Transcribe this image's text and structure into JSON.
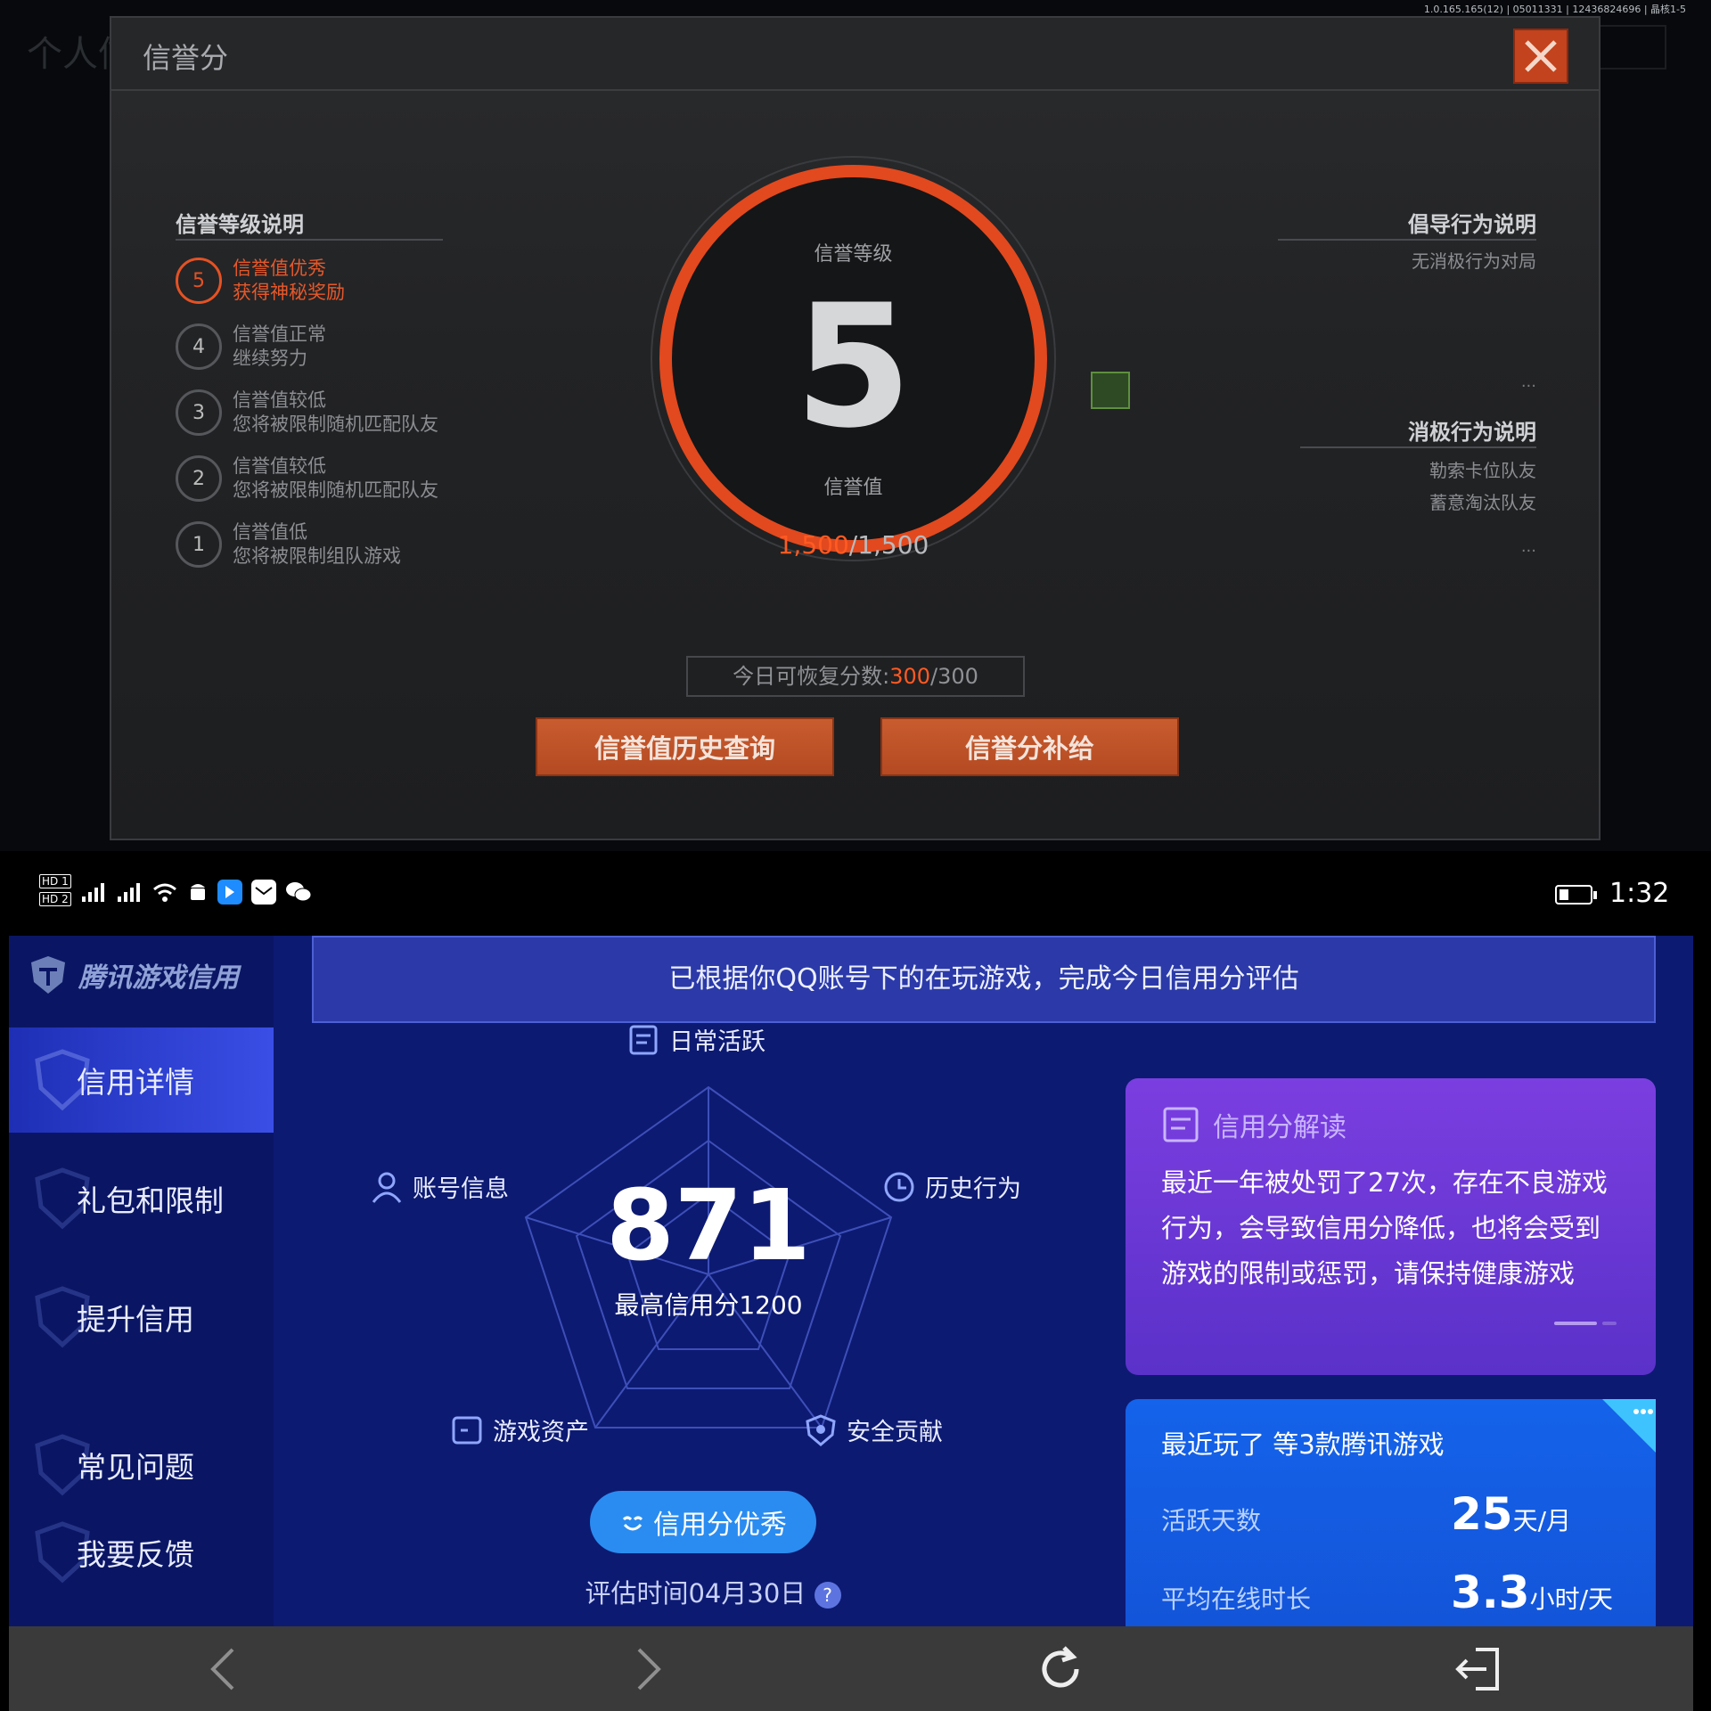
{
  "game": {
    "version": "1.0.165.165(12) | 05011331 | 12436824696 | 晶核1-5",
    "bg_title": "个人信",
    "dialog_title": "信誉分",
    "left_title": "信誉等级说明",
    "levels": [
      {
        "num": "5",
        "line1": "信誉值优秀",
        "line2": "获得神秘奖励"
      },
      {
        "num": "4",
        "line1": "信誉值正常",
        "line2": "继续努力"
      },
      {
        "num": "3",
        "line1": "信誉值较低",
        "line2": "您将被限制随机匹配队友"
      },
      {
        "num": "2",
        "line1": "信誉值较低",
        "line2": "您将被限制随机匹配队友"
      },
      {
        "num": "1",
        "line1": "信誉值低",
        "line2": "您将被限制组队游戏"
      }
    ],
    "ring": {
      "level_label": "信誉等级",
      "level": "5",
      "score_label": "信誉值",
      "score_current": "1,500",
      "score_max": "/1,500"
    },
    "advocate_title": "倡导行为说明",
    "advocate_item": "无消极行为对局",
    "negative_title": "消极行为说明",
    "negative_items": [
      "勒索卡位队友",
      "蓄意淘汰队友"
    ],
    "ellipsis": "...",
    "daily_label": "今日可恢复分数:",
    "daily_current": "300",
    "daily_max": "/300",
    "btn_history": "信誉值历史查询",
    "btn_supplement": "信誉分补给"
  },
  "statusbar": {
    "time": "1:32",
    "hd1": "HD 1",
    "hd2": "HD 2"
  },
  "app": {
    "brand": "腾讯游戏信用",
    "nav": [
      "信用详情",
      "礼包和限制",
      "提升信用",
      "常见问题",
      "我要反馈"
    ],
    "banner": "已根据你QQ账号下的在玩游戏，完成今日信用分评估",
    "radar_labels": {
      "daily": "日常活跃",
      "account": "账号信息",
      "history": "历史行为",
      "assets": "游戏资产",
      "security": "安全贡献"
    },
    "score": "871",
    "score_sub": "最高信用分1200",
    "pill": "信用分优秀",
    "eval": "评估时间04月30日",
    "eval_q": "?",
    "purple_title": "信用分解读",
    "purple_body": "最近一年被处罚了27次，存在不良游戏行为，会导致信用分降低，也将会受到游戏的限制或惩罚，请保持健康游戏",
    "blue_title": "最近玩了 等3款腾讯游戏",
    "blue_rows": [
      {
        "k": "活跃天数",
        "v": "25",
        "u": "天/月"
      },
      {
        "k": "平均在线时长",
        "v": "3.3",
        "u": "小时/天"
      }
    ],
    "blue_corner_dots": "•••"
  },
  "colors": {
    "accent_orange": "#e2491e",
    "app_bg": "#0d1a72",
    "nav_active": "#2a3bd0",
    "purple_card": "#6a36d6",
    "blue_card": "#1463ea",
    "pill_blue": "#2a8cf0"
  }
}
